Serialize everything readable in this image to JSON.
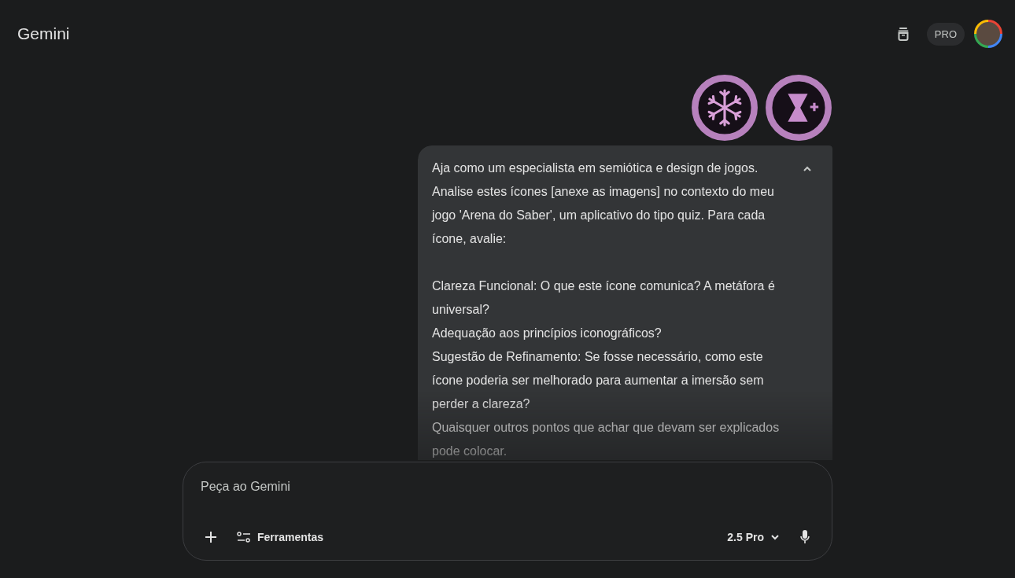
{
  "header": {
    "title": "Gemini",
    "plan_badge": "PRO"
  },
  "message": {
    "attachments": [
      {
        "kind": "snowflake"
      },
      {
        "kind": "hourglass"
      }
    ],
    "sections": [
      [
        "Aja como um especialista em semiótica e design de jogos. Analise estes ícones [anexe as imagens] no contexto do meu jogo 'Arena do Saber', um aplicativo do tipo quiz. Para cada ícone, avalie:"
      ],
      [
        "Clareza Funcional: O que este ícone comunica? A metáfora é universal?",
        "Adequação aos princípios iconográficos?",
        "Sugestão de Refinamento: Se fosse necessário, como este ícone poderia ser melhorado para aumentar a imersão sem perder a clareza?",
        "Quaisquer outros pontos que achar que devam ser explicados pode colocar."
      ]
    ],
    "expanded": true
  },
  "prompt": {
    "placeholder": "Peça ao Gemini",
    "tools_label": "Ferramentas",
    "model": "2.5 Pro"
  }
}
